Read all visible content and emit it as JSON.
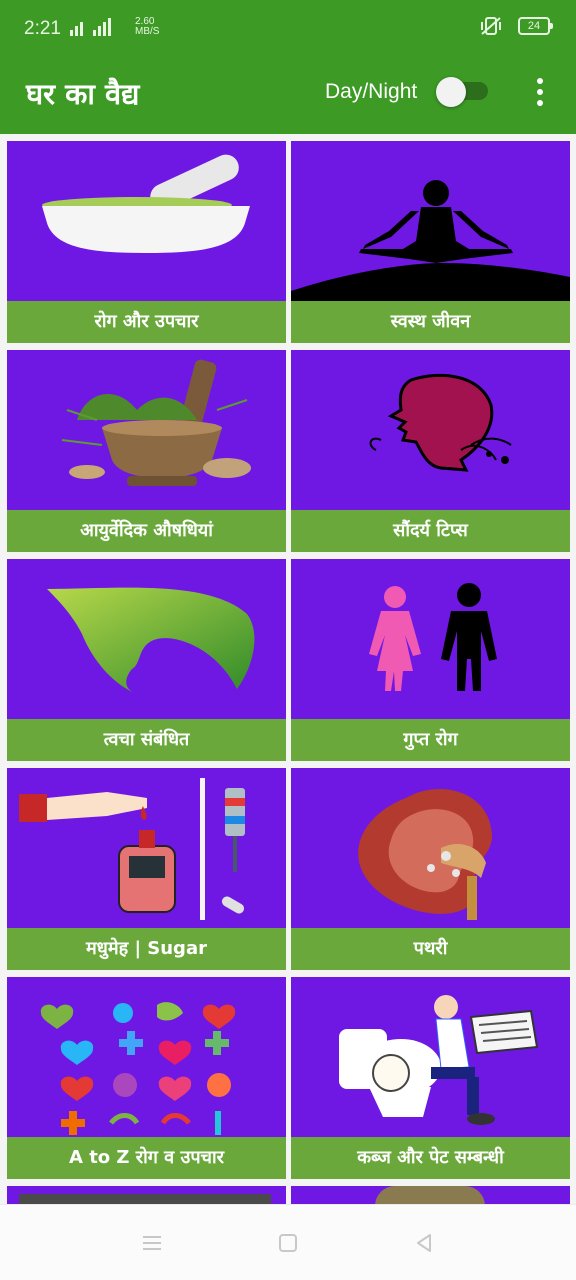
{
  "status_bar": {
    "time": "2:21",
    "network": "4G",
    "speed_top": "2.60",
    "speed_bottom": "MB/S",
    "battery": "24"
  },
  "app_bar": {
    "title": "घर का वैद्य",
    "toggle_label": "Day/Night",
    "toggle_on": false,
    "colors": {
      "primary": "#3c9a25",
      "tile": "#6f18e4",
      "label_bar": "#6aa83c"
    }
  },
  "tiles": [
    {
      "label": "रोग और उपचार",
      "icon": "mortar-pestle-icon"
    },
    {
      "label": "स्वस्थ जीवन",
      "icon": "yoga-meditation-icon"
    },
    {
      "label": "आयुर्वेदिक औषधियां",
      "icon": "herbal-mortar-icon"
    },
    {
      "label": "सौंदर्य टिप्स",
      "icon": "woman-face-icon"
    },
    {
      "label": "त्वचा संबंधित",
      "icon": "leaf-face-icon"
    },
    {
      "label": "गुप्त रोग",
      "icon": "man-woman-icon"
    },
    {
      "label": "मधुमेह | Sugar",
      "icon": "glucometer-icon"
    },
    {
      "label": "पथरी",
      "icon": "kidney-icon"
    },
    {
      "label": "A to Z रोग व उपचार",
      "icon": "health-symbols-icon"
    },
    {
      "label": "कब्ज और पेट सम्बन्धी",
      "icon": "toilet-reading-icon"
    }
  ],
  "nav": {
    "items": [
      "menu-icon",
      "home-icon",
      "back-icon"
    ]
  }
}
